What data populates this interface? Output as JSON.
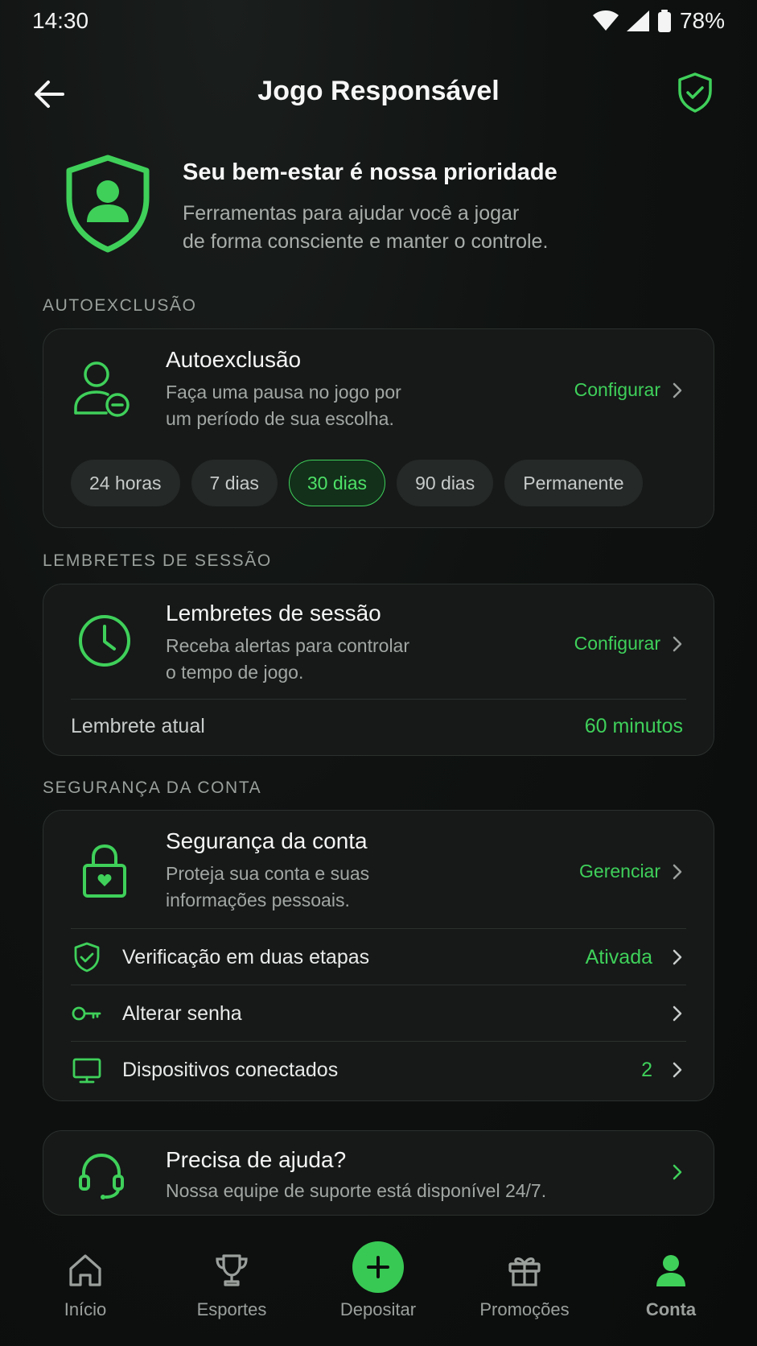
{
  "status_bar": {
    "time": "14:30",
    "battery": "78%"
  },
  "header": {
    "title": "Jogo Responsável"
  },
  "hero": {
    "title": "Seu bem-estar é nossa prioridade",
    "subtitle_line1": "Ferramentas para ajudar você a jogar",
    "subtitle_line2": "de forma consciente e manter o controle."
  },
  "self_exclusion": {
    "section_label": "AUTOEXCLUSÃO",
    "title": "Autoexclusão",
    "subtitle_line1": "Faça uma pausa no jogo por",
    "subtitle_line2": "um período de sua escolha.",
    "action": "Configurar",
    "options": [
      "24 horas",
      "7 dias",
      "30 dias",
      "90 dias",
      "Permanente"
    ],
    "selected": "30 dias"
  },
  "session_reminders": {
    "section_label": "LEMBRETES DE SESSÃO",
    "title": "Lembretes de sessão",
    "subtitle_line1": "Receba alertas para controlar",
    "subtitle_line2": "o tempo de jogo.",
    "action": "Configurar",
    "current_label": "Lembrete atual",
    "current_value": "60 minutos"
  },
  "account_security": {
    "section_label": "SEGURANÇA DA CONTA",
    "title": "Segurança da conta",
    "subtitle_line1": "Proteja sua conta e suas",
    "subtitle_line2": "informações pessoais.",
    "action": "Gerenciar",
    "rows": [
      {
        "label": "Verificação em duas etapas",
        "value": "Ativada",
        "icon": "shield-check-icon"
      },
      {
        "label": "Alterar senha",
        "value": "",
        "icon": "key-icon"
      },
      {
        "label": "Dispositivos conectados",
        "value": "2",
        "icon": "monitor-icon"
      }
    ]
  },
  "help": {
    "title": "Precisa de ajuda?",
    "subtitle": "Nossa equipe de suporte está disponível 24/7."
  },
  "bottom_nav": {
    "items": [
      {
        "label": "Início",
        "icon": "home-icon"
      },
      {
        "label": "Esportes",
        "icon": "trophy-icon"
      },
      {
        "label": "Depositar",
        "icon": "plus-icon"
      },
      {
        "label": "Promoções",
        "icon": "gift-icon"
      },
      {
        "label": "Conta",
        "icon": "user-icon"
      }
    ],
    "active": "Conta"
  },
  "colors": {
    "accent": "#3fd05a",
    "background": "#0d0f0e",
    "card": "#161918"
  }
}
